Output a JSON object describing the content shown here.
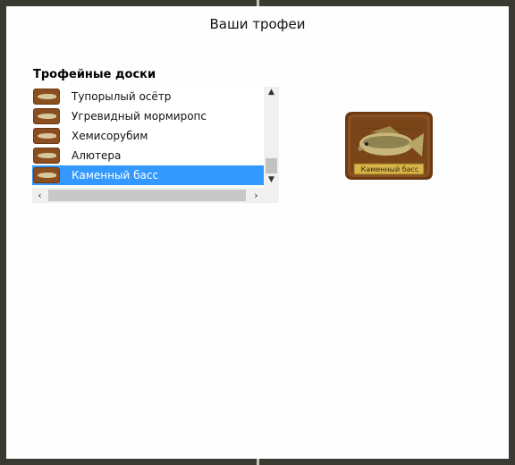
{
  "window": {
    "title": "Ваши трофеи"
  },
  "trophy_boards": {
    "heading": "Трофейные доски",
    "items": [
      {
        "label": "Тупорылый осётр",
        "selected": false
      },
      {
        "label": "Угревидный мормиропс",
        "selected": false
      },
      {
        "label": "Хемисорубим",
        "selected": false
      },
      {
        "label": "Алютера",
        "selected": false
      },
      {
        "label": "Каменный басс",
        "selected": true
      }
    ]
  },
  "preview": {
    "caption": "Каменный басс",
    "colors": {
      "wood": "#7a4519",
      "plate": "#d9b64a",
      "fish": "#c8b77a"
    }
  },
  "colors": {
    "selection": "#3399ff",
    "frame": "#3a3a33",
    "background": "#fefefe"
  }
}
